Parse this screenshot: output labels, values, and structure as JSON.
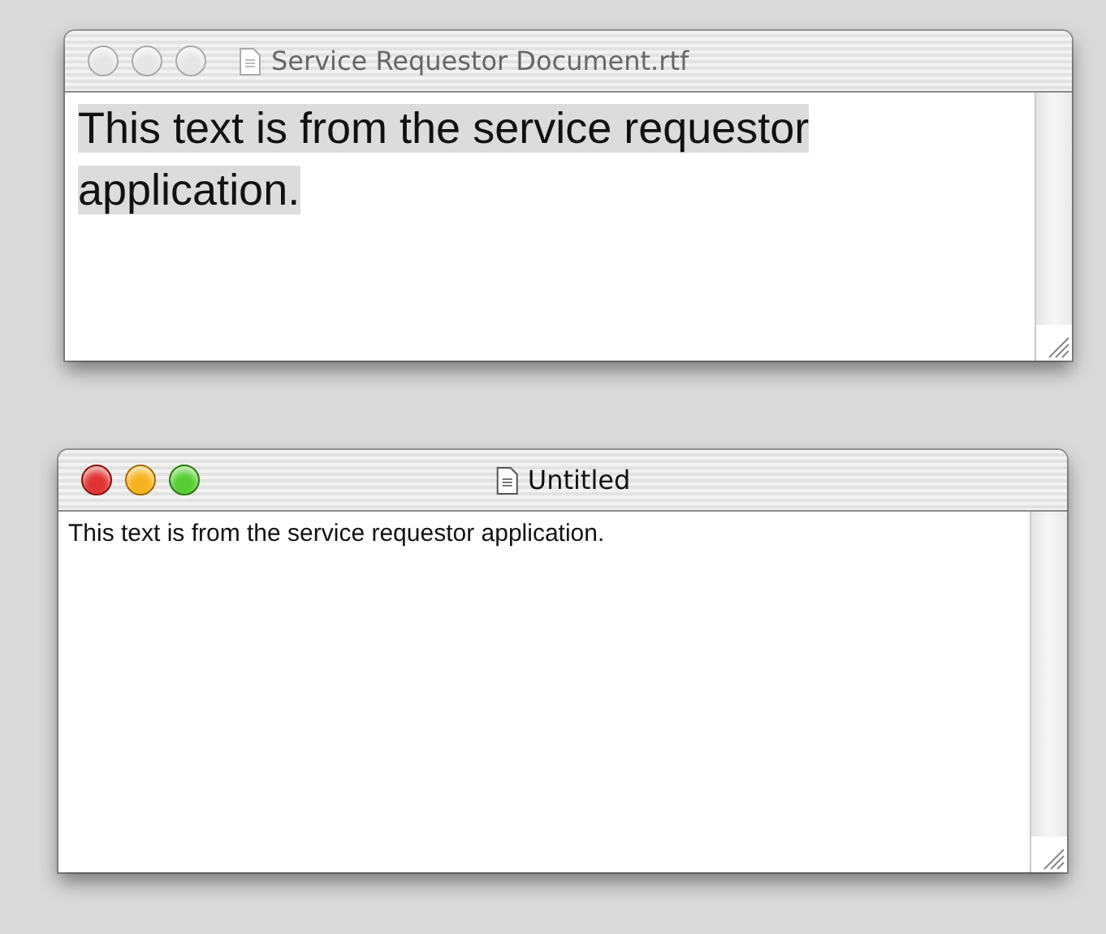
{
  "windows": [
    {
      "title": "Service Requestor Document.rtf",
      "active": false,
      "text": "This text is from the service requestor application.",
      "text_selected": true
    },
    {
      "title": "Untitled",
      "active": true,
      "text": "This text is from the service requestor application.",
      "text_selected": false
    }
  ]
}
